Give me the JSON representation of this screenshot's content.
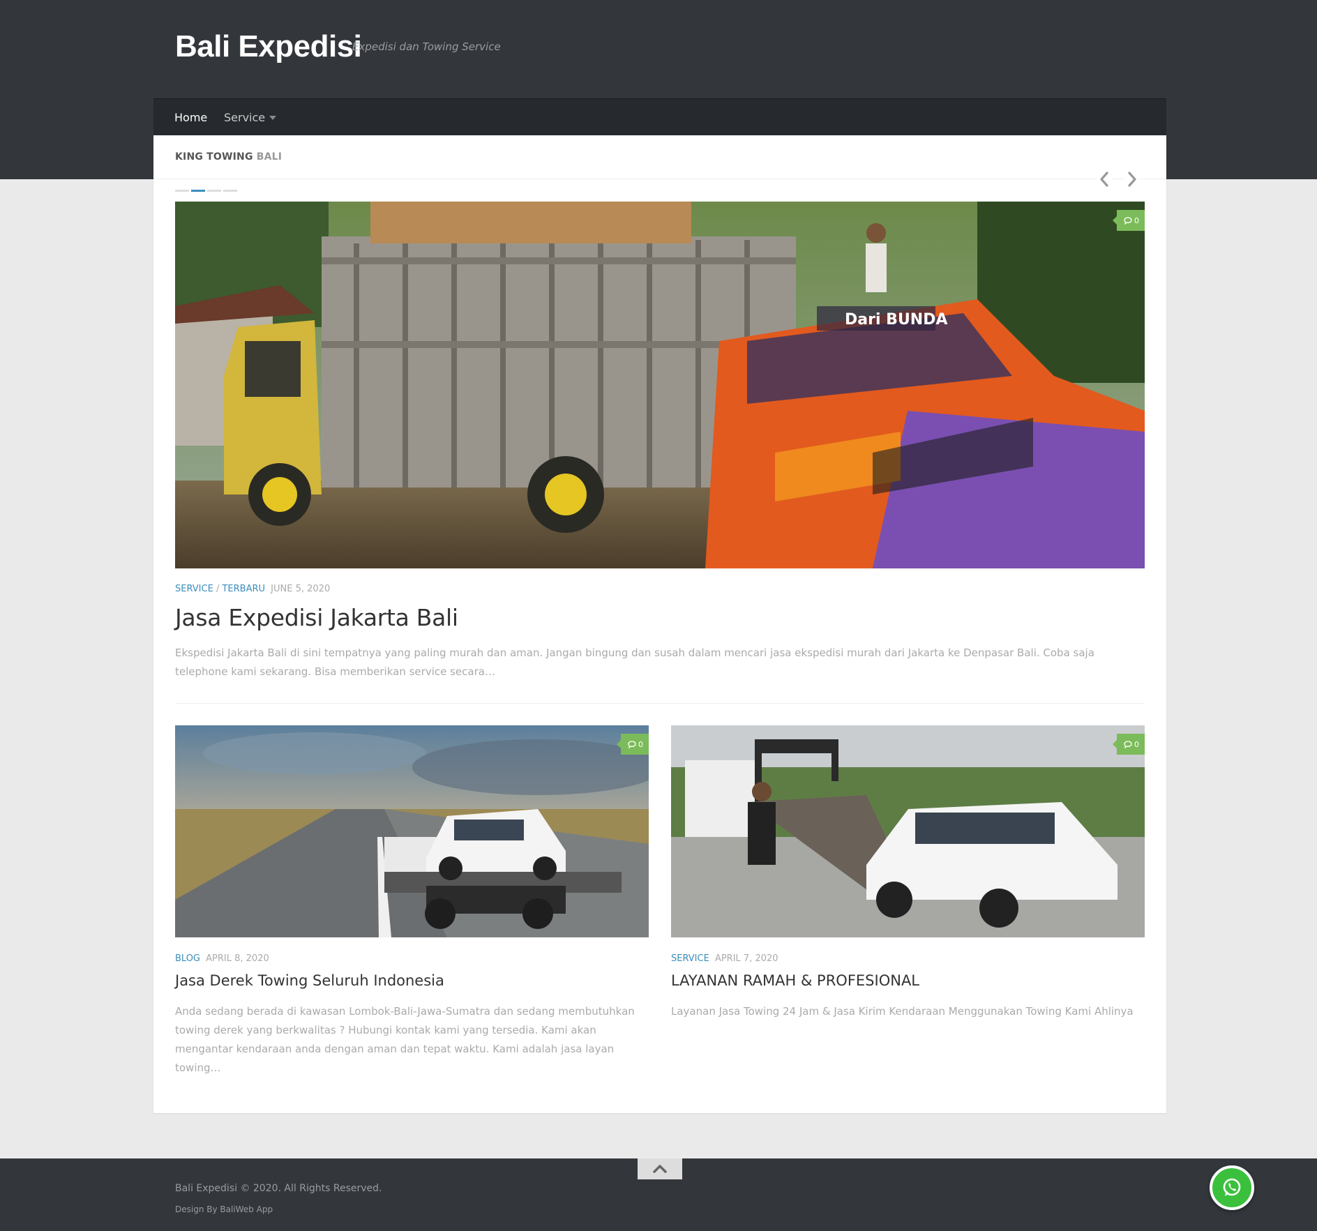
{
  "site": {
    "title": "Bali Expedisi",
    "tagline": "Expedisi dan Towing Service"
  },
  "nav": {
    "home": "Home",
    "service": "Service"
  },
  "section": {
    "title_bold": "KING TOWING",
    "title_light": "BALI"
  },
  "slider": {
    "dot_count": 4,
    "active_dot": 2
  },
  "featured": {
    "category1": "SERVICE",
    "separator": "/",
    "category2": "TERBARU",
    "date": "JUNE 5, 2020",
    "title": "Jasa Expedisi Jakarta Bali",
    "excerpt": "Ekspedisi Jakarta Bali di sini tempatnya yang paling murah dan aman. Jangan bingung dan susah dalam mencari jasa ekspedisi murah dari Jakarta ke Denpasar Bali. Coba saja telephone kami sekarang. Bisa memberikan service secara…",
    "comments": "0",
    "image_text_1": "Dari",
    "image_text_2": "BUNDA"
  },
  "posts": [
    {
      "category": "BLOG",
      "date": "APRIL 8, 2020",
      "title": "Jasa Derek Towing Seluruh Indonesia",
      "excerpt": "Anda sedang berada di kawasan Lombok-Bali-Jawa-Sumatra dan sedang membutuhkan towing derek yang berkwalitas ? Hubungi kontak kami yang tersedia. Kami akan mengantar kendaraan anda dengan aman dan tepat waktu. Kami adalah jasa layan towing…",
      "comments": "0"
    },
    {
      "category": "SERVICE",
      "date": "APRIL 7, 2020",
      "title": "LAYANAN RAMAH & PROFESIONAL",
      "excerpt": "Layanan Jasa Towing 24 Jam & Jasa Kirim Kendaraan Menggunakan Towing Kami Ahlinya",
      "comments": "0"
    }
  ],
  "footer": {
    "copyright": "Bali Expedisi © 2020. All Rights Reserved.",
    "design": "Design By BaliWeb App"
  },
  "colors": {
    "header_bg": "#33363b",
    "accent_blue": "#3b8dbd",
    "comment_green": "#7cbb5a",
    "whatsapp_green": "#3ac03d"
  },
  "icons": {
    "prev": "chevron-left-icon",
    "next": "chevron-right-icon",
    "comment": "comment-icon",
    "back_to_top": "chevron-up-icon",
    "whatsapp": "whatsapp-icon",
    "dropdown": "caret-down-icon"
  }
}
